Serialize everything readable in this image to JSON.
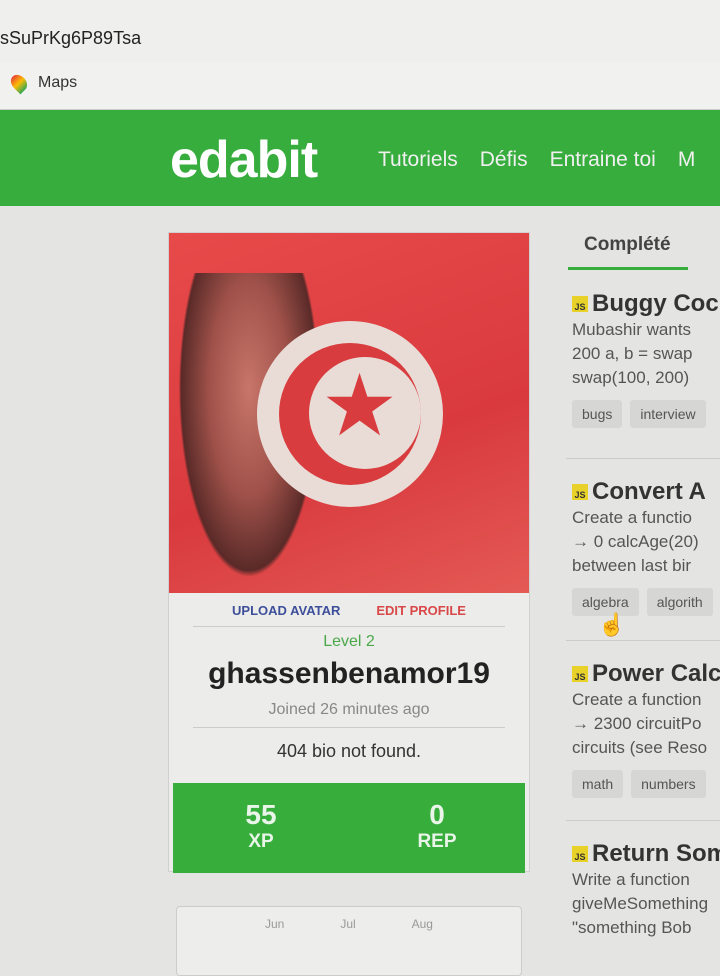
{
  "browser": {
    "url_fragment": "sSuPrKg6P89Tsa",
    "bookmark": "Maps"
  },
  "nav": {
    "logo": "edabit",
    "items": [
      "Tutoriels",
      "Défis",
      "Entraine toi",
      "M"
    ]
  },
  "profile": {
    "upload_avatar": "UPLOAD AVATAR",
    "edit_profile": "EDIT PROFILE",
    "level": "Level 2",
    "username": "ghassenbenamor19",
    "joined": "Joined 26 minutes ago",
    "bio": "404 bio not found.",
    "xp": "55",
    "xp_label": "XP",
    "rep": "0",
    "rep_label": "REP"
  },
  "calendar": {
    "months": [
      "Jun",
      "Jul",
      "Aug"
    ]
  },
  "tab": "Complété",
  "challenges": [
    {
      "lang": "JS",
      "title": "Buggy Coc",
      "desc": [
        "Mubashir wants",
        "200 a, b = swap",
        "swap(100, 200)"
      ],
      "tags": [
        "bugs",
        "interview"
      ]
    },
    {
      "lang": "JS",
      "title": "Convert A",
      "desc": [
        "Create a functio",
        "→ 0 calcAge(20)",
        "between last bir"
      ],
      "tags": [
        "algebra",
        "algorith"
      ]
    },
    {
      "lang": "JS",
      "title": "Power Calc",
      "desc": [
        "Create a function",
        "→ 2300 circuitPo",
        "circuits (see Reso"
      ],
      "tags": [
        "math",
        "numbers"
      ]
    },
    {
      "lang": "JS",
      "title": "Return Som",
      "desc": [
        "Write a function",
        "giveMeSomething",
        "\"something Bob"
      ],
      "tags": []
    }
  ],
  "colors": {
    "brand_green": "#36ad3c",
    "upload": "#3d4f9a",
    "edit": "#d94848"
  }
}
